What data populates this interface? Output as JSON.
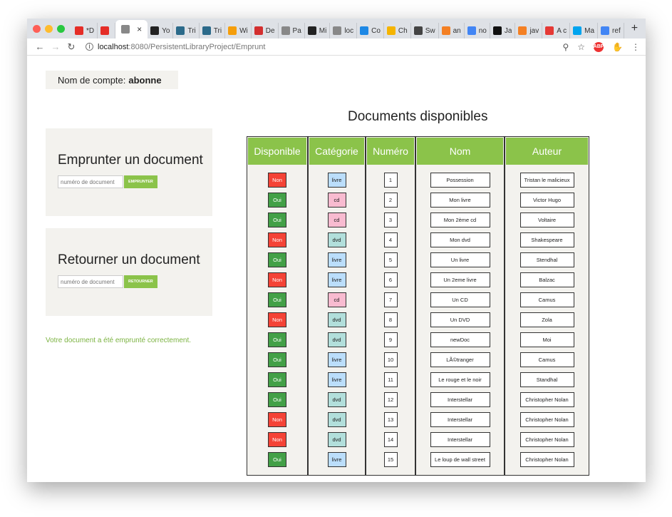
{
  "browser": {
    "tabs": [
      {
        "label": "*D",
        "icon": "youtube-icon",
        "color": "#e52d27"
      },
      {
        "label": "",
        "icon": "youtube-icon",
        "color": "#e52d27"
      },
      {
        "label": "",
        "icon": "file-icon",
        "color": "#888888",
        "active": true
      },
      {
        "label": "Yo",
        "icon": "github-icon",
        "color": "#222222"
      },
      {
        "label": "Tri",
        "icon": "react-icon",
        "color": "#2b6a8a"
      },
      {
        "label": "Tri",
        "icon": "react-icon",
        "color": "#2b6a8a"
      },
      {
        "label": "Wi",
        "icon": "share-icon",
        "color": "#f59e0b"
      },
      {
        "label": "De",
        "icon": "pin-icon",
        "color": "#d32f2f"
      },
      {
        "label": "Pa",
        "icon": "file-icon",
        "color": "#888888"
      },
      {
        "label": "Mi",
        "icon": "bs-icon",
        "color": "#222222"
      },
      {
        "label": "loc",
        "icon": "file-icon",
        "color": "#888888"
      },
      {
        "label": "Co",
        "icon": "infinity-icon",
        "color": "#1e88e5"
      },
      {
        "label": "Ch",
        "icon": "hand-icon",
        "color": "#f5b400"
      },
      {
        "label": "Sw",
        "icon": "gem-icon",
        "color": "#444444"
      },
      {
        "label": "an",
        "icon": "stack-icon",
        "color": "#f48024"
      },
      {
        "label": "no",
        "icon": "google-icon",
        "color": "#4285f4"
      },
      {
        "label": "Ja",
        "icon": "j-icon",
        "color": "#111111"
      },
      {
        "label": "jav",
        "icon": "stack-icon",
        "color": "#f48024"
      },
      {
        "label": "A c",
        "icon": "target-icon",
        "color": "#e53935"
      },
      {
        "label": "Ma",
        "icon": "windows-icon",
        "color": "#00a4ef"
      },
      {
        "label": "ref",
        "icon": "google-icon",
        "color": "#4285f4"
      }
    ],
    "new_tab": "+",
    "url_host": "localhost",
    "url_path": ":8080/PersistentLibraryProject/Emprunt",
    "abp": "ABP"
  },
  "account": {
    "label": "Nom de compte:",
    "name": "abonne"
  },
  "borrow": {
    "title": "Emprunter un document",
    "placeholder": "numéro de document",
    "button": "EMPRUNTER"
  },
  "return": {
    "title": "Retourner un document",
    "placeholder": "numéro de document",
    "button": "RETOURNER"
  },
  "message": "Votre document a été emprunté correctement.",
  "documents": {
    "title": "Documents disponibles",
    "headers": [
      "Disponible",
      "Catégorie",
      "Numéro",
      "Nom",
      "Auteur"
    ],
    "rows": [
      {
        "dispo": "Non",
        "cat": "livre",
        "num": "1",
        "nom": "Possession",
        "auteur": "Tristan le malicieux"
      },
      {
        "dispo": "Oui",
        "cat": "cd",
        "num": "2",
        "nom": "Mon livre",
        "auteur": "Victor Hugo"
      },
      {
        "dispo": "Oui",
        "cat": "cd",
        "num": "3",
        "nom": "Mon 2ème cd",
        "auteur": "Voltaire"
      },
      {
        "dispo": "Non",
        "cat": "dvd",
        "num": "4",
        "nom": "Mon dvd",
        "auteur": "Shakespeare"
      },
      {
        "dispo": "Oui",
        "cat": "livre",
        "num": "5",
        "nom": "Un livre",
        "auteur": "Stendhal"
      },
      {
        "dispo": "Non",
        "cat": "livre",
        "num": "6",
        "nom": "Un 2eme livre",
        "auteur": "Balzac"
      },
      {
        "dispo": "Oui",
        "cat": "cd",
        "num": "7",
        "nom": "Un CD",
        "auteur": "Camus"
      },
      {
        "dispo": "Non",
        "cat": "dvd",
        "num": "8",
        "nom": "Un DVD",
        "auteur": "Zola"
      },
      {
        "dispo": "Oui",
        "cat": "dvd",
        "num": "9",
        "nom": "newDoc",
        "auteur": "Moi"
      },
      {
        "dispo": "Oui",
        "cat": "livre",
        "num": "10",
        "nom": "LÃ©tranger",
        "auteur": "Camus"
      },
      {
        "dispo": "Oui",
        "cat": "livre",
        "num": "11",
        "nom": "Le rouge et le noir",
        "auteur": "Standhal"
      },
      {
        "dispo": "Oui",
        "cat": "dvd",
        "num": "12",
        "nom": "Interstellar",
        "auteur": "Christopher Nolan"
      },
      {
        "dispo": "Non",
        "cat": "dvd",
        "num": "13",
        "nom": "Interstellar",
        "auteur": "Christopher Nolan"
      },
      {
        "dispo": "Non",
        "cat": "dvd",
        "num": "14",
        "nom": "Interstellar",
        "auteur": "Christopher Nolan"
      },
      {
        "dispo": "Oui",
        "cat": "livre",
        "num": "15",
        "nom": "Le loup de wall street",
        "auteur": "Christopher Nolan"
      }
    ]
  },
  "colors": {
    "accent": "#8bc34a",
    "oui": "#43a047",
    "non": "#f44336",
    "livre": "#bbdefb",
    "cd": "#f8bbd0",
    "dvd": "#b2dfdb",
    "panel": "#f3f2ee"
  }
}
